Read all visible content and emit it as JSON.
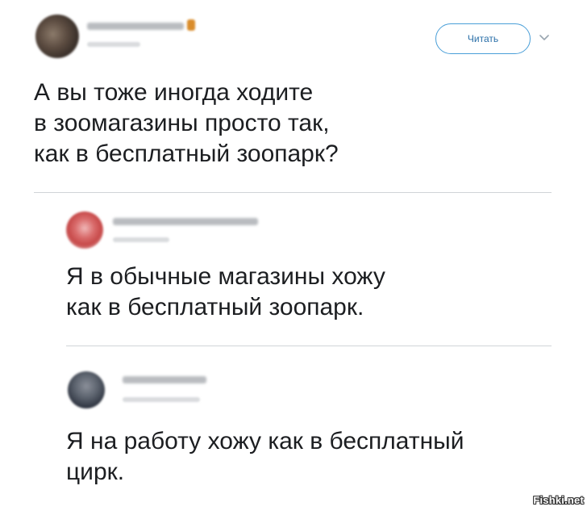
{
  "tweet": {
    "follow_label": "Читать",
    "lines": [
      "А вы тоже иногда ходите",
      "в зоомагазины просто так,",
      "как в бесплатный зоопарк?"
    ]
  },
  "replies": [
    {
      "lines": [
        "Я в обычные магазины хожу",
        "как в бесплатный зоопарк."
      ]
    },
    {
      "lines": [
        "Я на работу хожу как в бесплатный",
        "цирк."
      ]
    }
  ],
  "watermark": "Fishki.net",
  "icons": {
    "follow_menu": "chevron-down-icon"
  },
  "colors": {
    "follow_border": "#4a9fd8",
    "follow_text": "#2a6fa8",
    "divider": "#d0d4d8"
  }
}
